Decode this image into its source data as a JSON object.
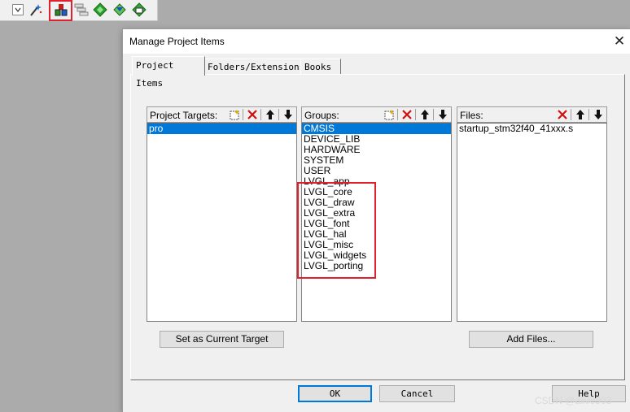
{
  "toolbar": {
    "icons": [
      "dropdown-arrow-icon",
      "magic-wand-icon",
      "manage-project-items-icon",
      "stack-layers-icon",
      "green-diamond-icon",
      "arrow-diamond-icon",
      "book-diamond-icon"
    ]
  },
  "dialog": {
    "title": "Manage Project Items",
    "close_glyph": "✕",
    "tabs": [
      "Project Items",
      "Folders/Extensions",
      "Books"
    ],
    "targets": {
      "label": "Project Targets:",
      "items": [
        "pro"
      ],
      "selected": 0,
      "button": "Set as Current Target"
    },
    "groups": {
      "label": "Groups:",
      "items": [
        "CMSIS",
        "DEVICE_LIB",
        "HARDWARE",
        "SYSTEM",
        "USER",
        "LVGL_app",
        "LVGL_core",
        "LVGL_draw",
        "LVGL_extra",
        "LVGL_font",
        "LVGL_hal",
        "LVGL_misc",
        "LVGL_widgets",
        "LVGL_porting"
      ],
      "selected": 0
    },
    "files": {
      "label": "Files:",
      "items": [
        "startup_stm32f40_41xxx.s"
      ],
      "button": "Add Files..."
    },
    "buttons": {
      "ok": "OK",
      "cancel": "Cancel",
      "help": "Help"
    }
  },
  "watermark": "CSDN @alive903",
  "colors": {
    "selection": "#0078d7",
    "highlight_box": "#e0202c"
  }
}
